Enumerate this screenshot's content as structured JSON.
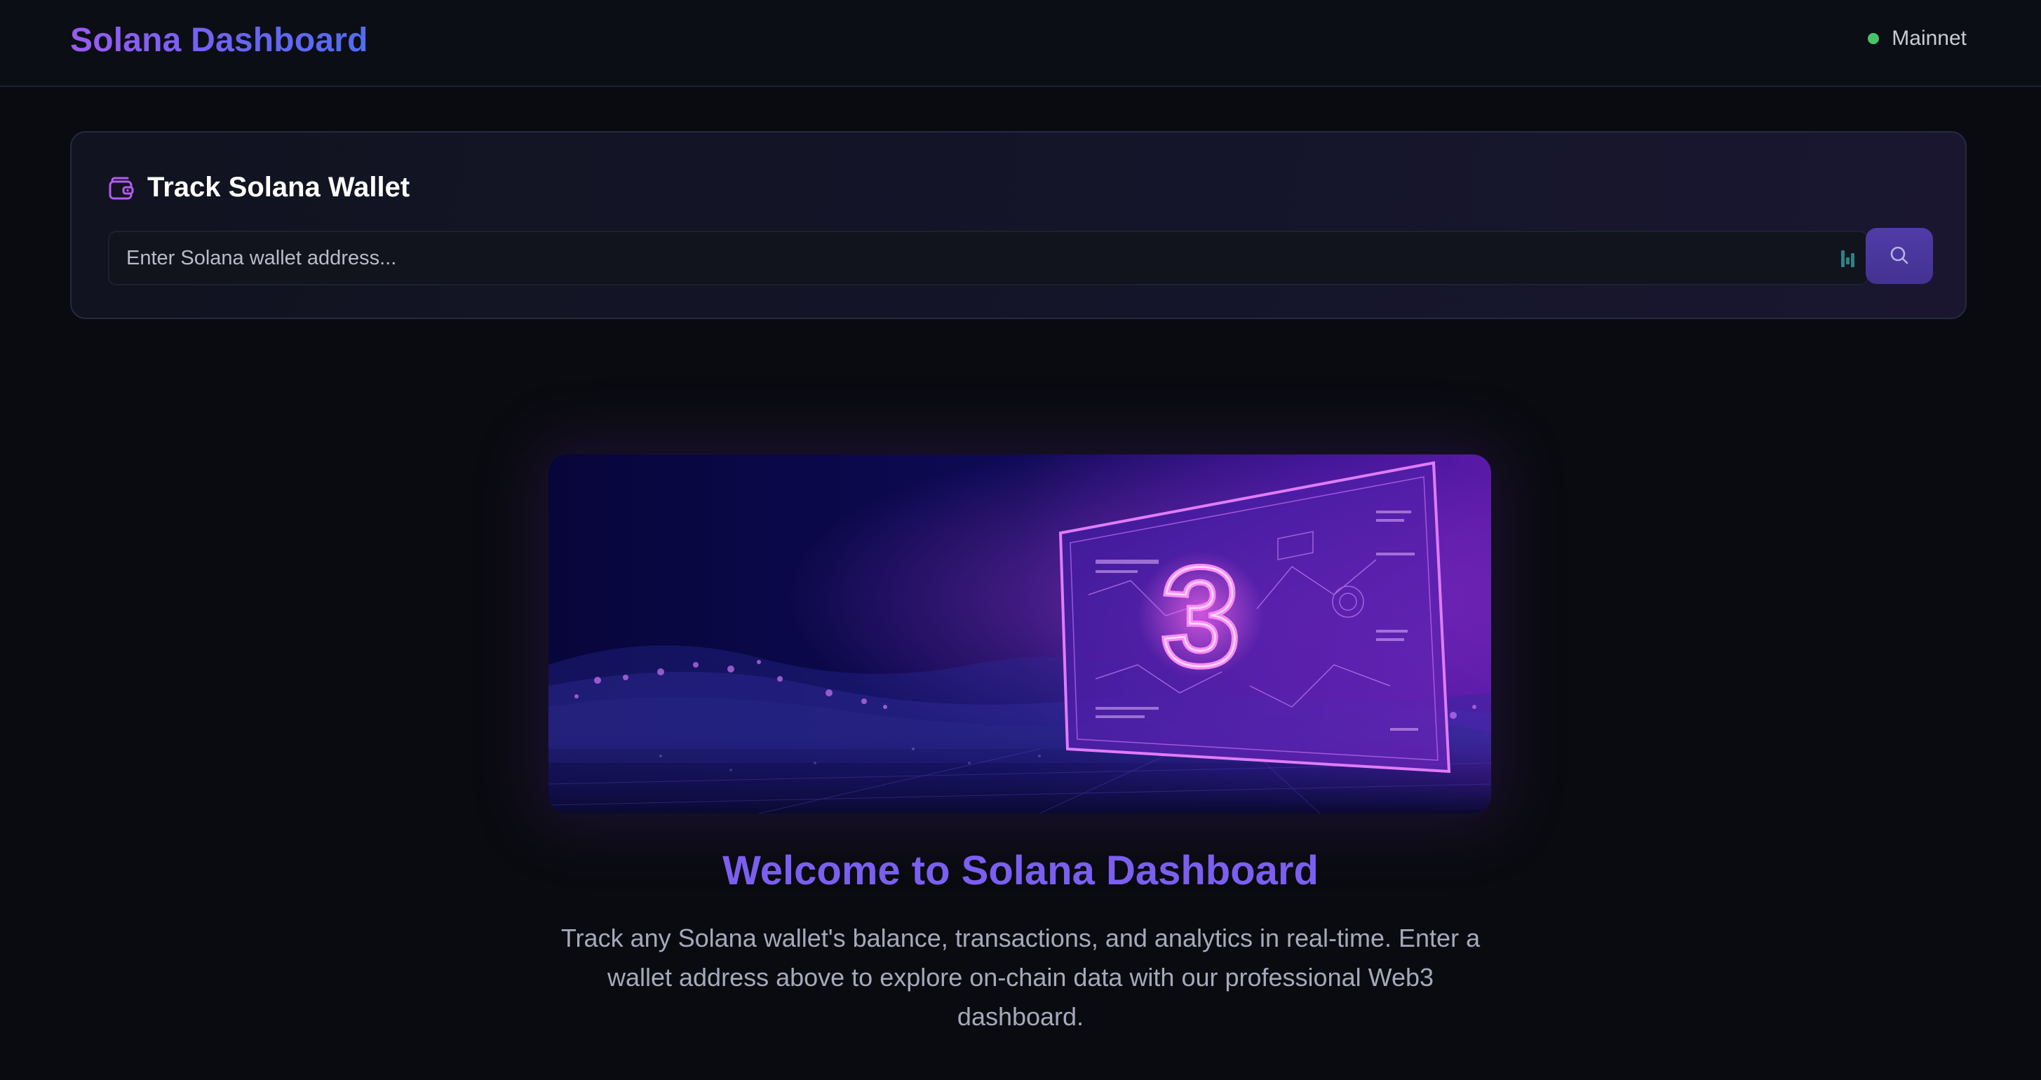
{
  "header": {
    "brand": "Solana Dashboard",
    "network_label": "Mainnet",
    "network_status_color": "#46c46a"
  },
  "tracker": {
    "title": "Track Solana Wallet",
    "title_icon": "wallet-icon",
    "input_placeholder": "Enter Solana wallet address...",
    "input_value": "",
    "search_icon": "search-icon"
  },
  "hero": {
    "image_description_icon": "web3-hero-image",
    "numeral": "3"
  },
  "welcome": {
    "title": "Welcome to Solana Dashboard",
    "description": "Track any Solana wallet's balance, transactions, and analytics in real-time. Enter a wallet address above to explore on-chain data with our professional Web3 dashboard."
  },
  "colors": {
    "background": "#0a0b10",
    "accent_purple": "#9a5cf0",
    "accent_blue": "#4f6ef0",
    "welcome_title": "#7b5ff0",
    "search_button": "#4f3ca8"
  }
}
